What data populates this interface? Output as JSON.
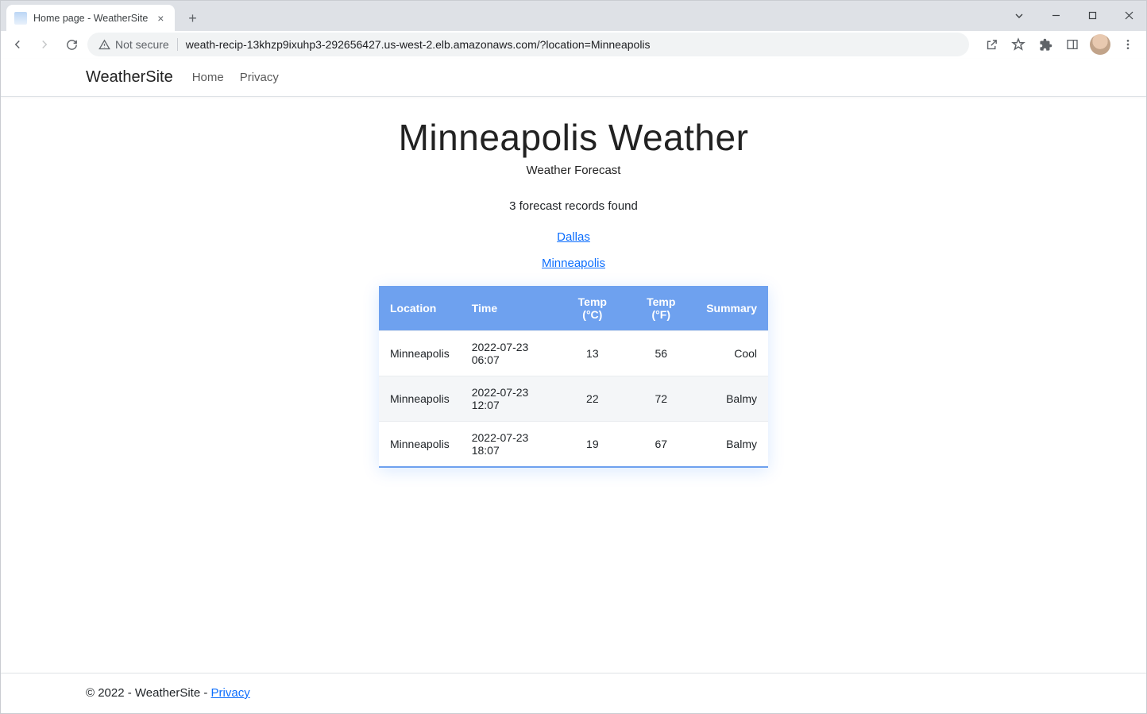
{
  "browser": {
    "tab_title": "Home page - WeatherSite",
    "security_label": "Not secure",
    "url": "weath-recip-13khzp9ixuhp3-292656427.us-west-2.elb.amazonaws.com/?location=Minneapolis"
  },
  "nav": {
    "brand": "WeatherSite",
    "links": [
      "Home",
      "Privacy"
    ]
  },
  "page": {
    "title": "Minneapolis Weather",
    "subtitle": "Weather Forecast",
    "records_found": "3 forecast records found",
    "location_links": [
      "Dallas",
      "Minneapolis"
    ]
  },
  "table": {
    "headers": {
      "location": "Location",
      "time": "Time",
      "temp_c": "Temp (°C)",
      "temp_f": "Temp (°F)",
      "summary": "Summary"
    },
    "rows": [
      {
        "location": "Minneapolis",
        "time": "2022-07-23 06:07",
        "temp_c": "13",
        "temp_f": "56",
        "summary": "Cool"
      },
      {
        "location": "Minneapolis",
        "time": "2022-07-23 12:07",
        "temp_c": "22",
        "temp_f": "72",
        "summary": "Balmy"
      },
      {
        "location": "Minneapolis",
        "time": "2022-07-23 18:07",
        "temp_c": "19",
        "temp_f": "67",
        "summary": "Balmy"
      }
    ]
  },
  "footer": {
    "text": "© 2022 - WeatherSite - ",
    "privacy": "Privacy"
  }
}
